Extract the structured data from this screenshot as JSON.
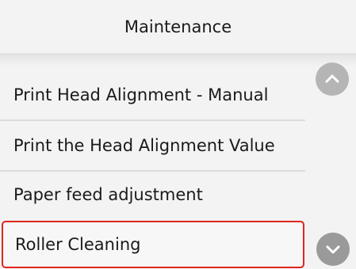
{
  "header": {
    "title": "Maintenance"
  },
  "menu": {
    "items": [
      {
        "label": "Print Head Alignment - Manual"
      },
      {
        "label": "Print the Head Alignment Value"
      },
      {
        "label": "Paper feed adjustment"
      },
      {
        "label": "Roller Cleaning",
        "selected": true
      }
    ]
  },
  "scroll": {
    "up_icon": "chevron-up-icon",
    "down_icon": "chevron-down-icon"
  },
  "colors": {
    "selection_border": "#e0261b",
    "scroll_button": "#9a9a9a",
    "background": "#f3f3f3"
  }
}
